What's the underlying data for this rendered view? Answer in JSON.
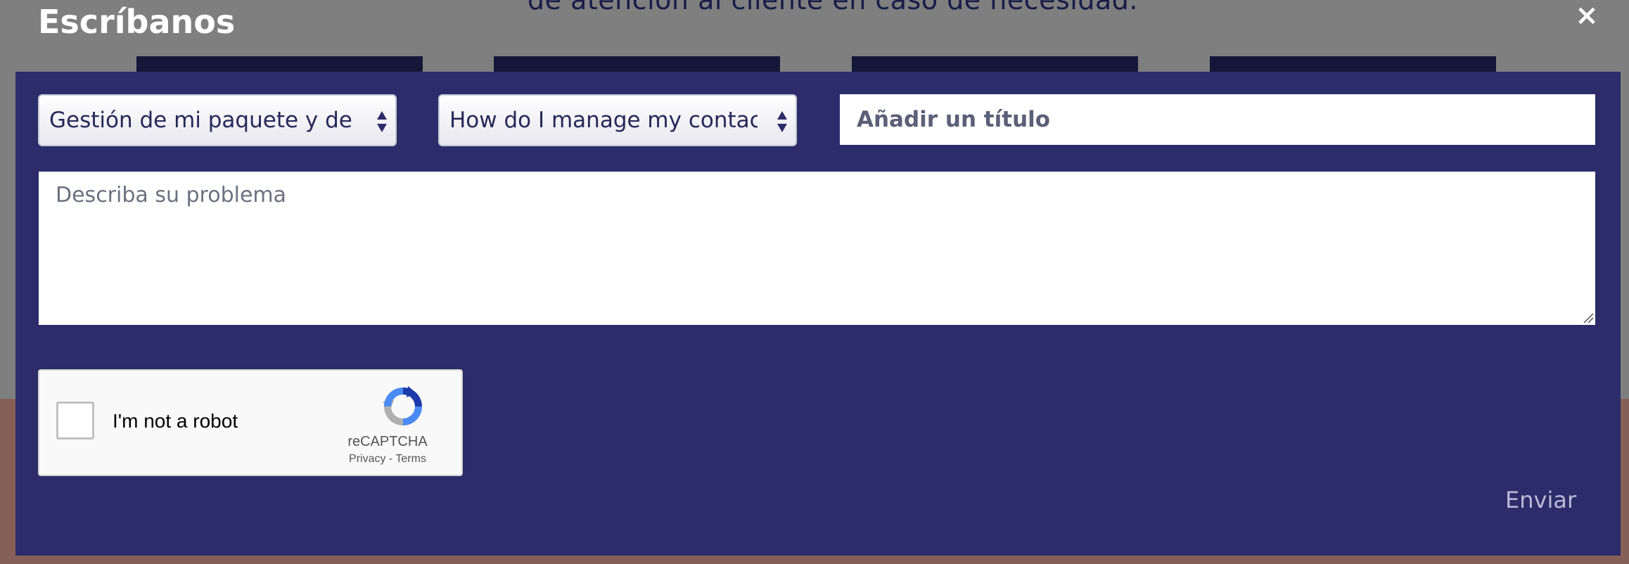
{
  "background": {
    "text": "de atención al cliente en caso de necesidad."
  },
  "modal": {
    "title": "Escríbanos",
    "close_icon": "close-icon",
    "category_select": {
      "selected": "Gestión de mi paquete y de mis contratos"
    },
    "question_select": {
      "selected": "How do I manage my contact details?"
    },
    "title_input": {
      "placeholder": "Añadir un título",
      "value": ""
    },
    "problem_textarea": {
      "placeholder": "Describa su problema",
      "value": ""
    },
    "recaptcha": {
      "label": "I'm not a robot",
      "brand": "reCAPTCHA",
      "privacy": "Privacy",
      "separator": "-",
      "terms": "Terms",
      "checked": false
    },
    "send_label": "Enviar"
  },
  "colors": {
    "overlay": "#7f7f7f",
    "panel": "#2b2c69",
    "title_text": "#ffffff",
    "send_text": "#b9bad6",
    "background_brown": "#866058"
  }
}
